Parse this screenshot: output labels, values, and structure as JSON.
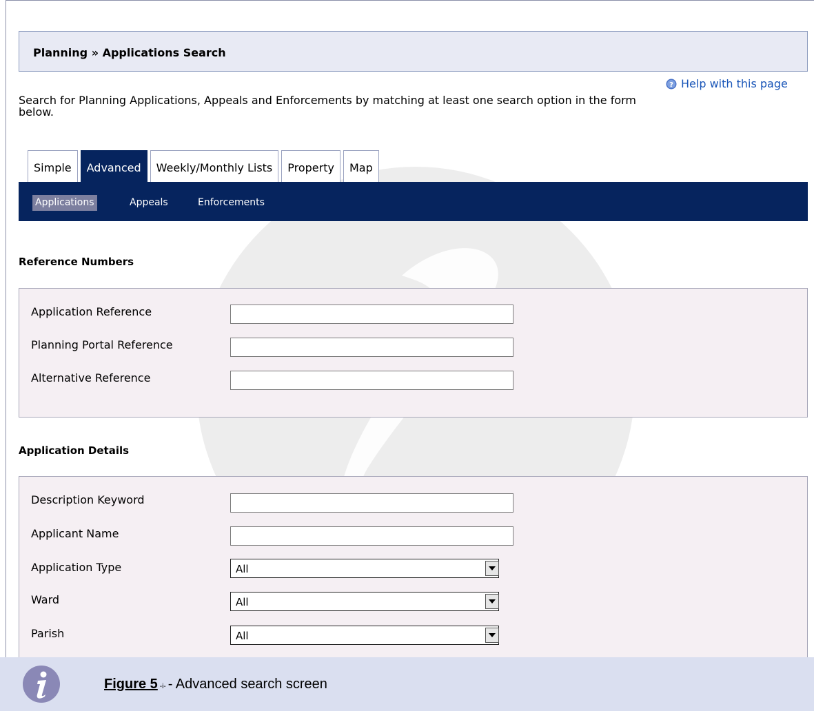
{
  "header": {
    "title": "Planning » Applications Search"
  },
  "help": {
    "label": "Help with this page",
    "icon": "help-icon"
  },
  "intro": "Search for Planning Applications, Appeals and Enforcements by matching at least one search option in the form below.",
  "tabs": [
    {
      "label": "Simple",
      "active": false
    },
    {
      "label": "Advanced",
      "active": true
    },
    {
      "label": "Weekly/Monthly Lists",
      "active": false
    },
    {
      "label": "Property",
      "active": false
    },
    {
      "label": "Map",
      "active": false
    }
  ],
  "subnav": [
    {
      "label": "Applications",
      "active": true
    },
    {
      "label": "Appeals",
      "active": false
    },
    {
      "label": "Enforcements",
      "active": false
    }
  ],
  "reference_section": {
    "heading": "Reference Numbers",
    "fields": [
      {
        "label": "Application Reference",
        "value": ""
      },
      {
        "label": "Planning Portal Reference",
        "value": ""
      },
      {
        "label": "Alternative Reference",
        "value": ""
      }
    ]
  },
  "details_section": {
    "heading": "Application Details",
    "fields": [
      {
        "label": "Description Keyword",
        "value": ""
      },
      {
        "label": "Applicant Name",
        "value": ""
      }
    ],
    "selects": [
      {
        "label": "Application Type",
        "value": "All"
      },
      {
        "label": "Ward",
        "value": "All"
      },
      {
        "label": "Parish",
        "value": "All"
      }
    ]
  },
  "caption": {
    "label": "Figure 5",
    "number": "-i-",
    "text": "- Advanced search screen",
    "icon": "info-icon"
  },
  "colors": {
    "nav": "#06245e",
    "title_bg": "#e8eaf4",
    "panel_bg": "#f5eff3",
    "caption_bg": "#dadff0",
    "link": "#1a56b8"
  }
}
